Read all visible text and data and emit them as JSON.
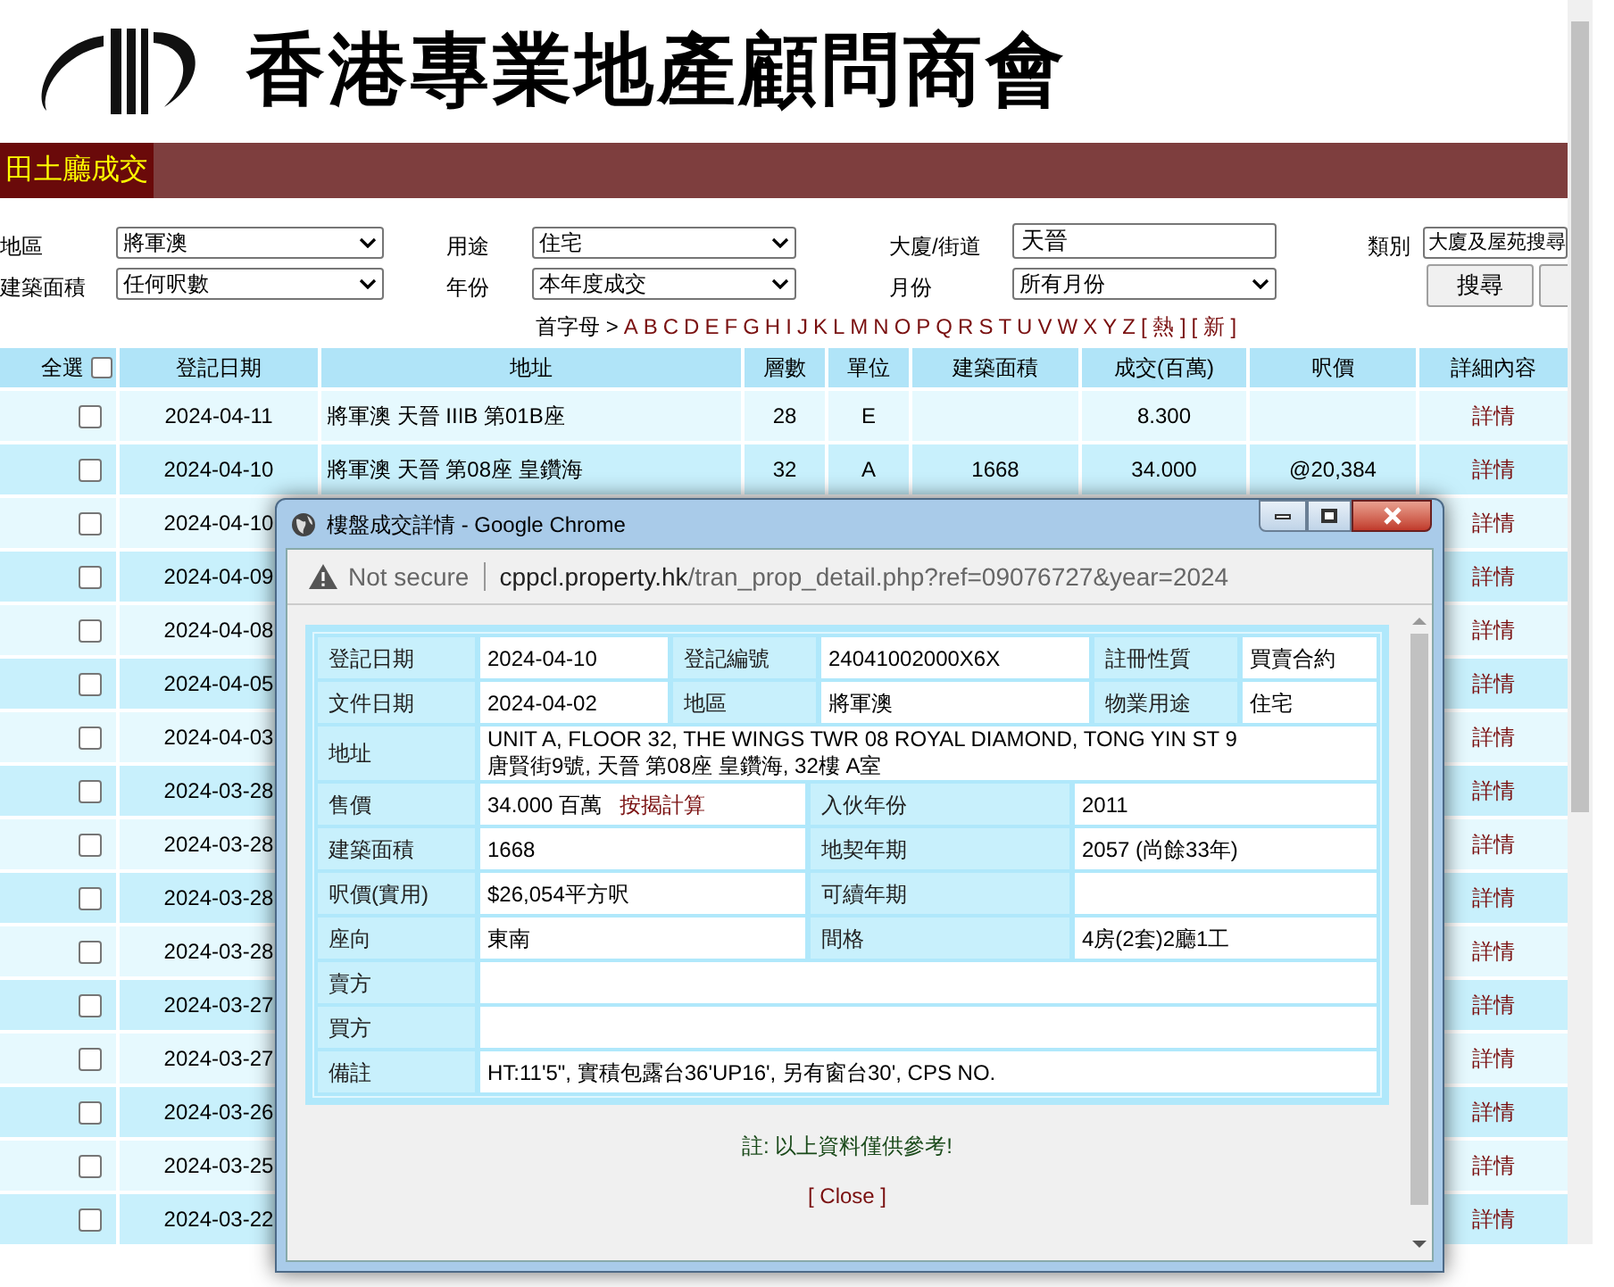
{
  "logo": {
    "title": "香港專業地產顧問商會"
  },
  "section_title": "田土廳成交",
  "filters": [
    {
      "label": "地區",
      "value": "將軍澳",
      "kind": "select"
    },
    {
      "label": "用途",
      "value": "住宅",
      "kind": "select"
    },
    {
      "label": "大廈/街道",
      "value": "天晉",
      "kind": "text"
    },
    {
      "label": "類別",
      "value": "大廈及屋苑搜尋",
      "kind": "select"
    },
    {
      "label": "建築面積",
      "value": "任何呎數",
      "kind": "select"
    },
    {
      "label": "年份",
      "value": "本年度成交",
      "kind": "select"
    },
    {
      "label": "月份",
      "value": "所有月份",
      "kind": "select"
    }
  ],
  "search_button": "搜尋",
  "letters": {
    "label": "首字母 >",
    "items": [
      "A",
      "B",
      "C",
      "D",
      "E",
      "F",
      "G",
      "H",
      "I",
      "J",
      "K",
      "L",
      "M",
      "N",
      "O",
      "P",
      "Q",
      "R",
      "S",
      "T",
      "U",
      "V",
      "W",
      "X",
      "Y",
      "Z",
      "[ 熱 ]",
      "[ 新 ]"
    ]
  },
  "table": {
    "select_all": {
      "label": "全選",
      "checked": false
    },
    "columns": [
      "登記日期",
      "地址",
      "層數",
      "單位",
      "建築面積",
      "成交(百萬)",
      "呎價",
      "詳細內容"
    ],
    "rows": [
      {
        "checked": false,
        "cells": [
          "2024-04-11",
          "將軍澳 天晉 IIIB 第01B座",
          "28",
          "E",
          "",
          "8.300",
          ""
        ],
        "detail": "詳情"
      },
      {
        "checked": false,
        "cells": [
          "2024-04-10",
          "將軍澳 天晉 第08座 皇鑽海",
          "32",
          "A",
          "1668",
          "34.000",
          "@20,384"
        ],
        "detail": "詳情"
      },
      {
        "checked": false,
        "cells": [
          "2024-04-10"
        ],
        "detail": "詳情"
      },
      {
        "checked": false,
        "cells": [
          "2024-04-09"
        ],
        "detail": "詳情"
      },
      {
        "checked": false,
        "cells": [
          "2024-04-08"
        ],
        "detail": "詳情"
      },
      {
        "checked": false,
        "cells": [
          "2024-04-05"
        ],
        "detail": "詳情"
      },
      {
        "checked": false,
        "cells": [
          "2024-04-03"
        ],
        "detail": "詳情"
      },
      {
        "checked": false,
        "cells": [
          "2024-03-28"
        ],
        "detail": "詳情"
      },
      {
        "checked": false,
        "cells": [
          "2024-03-28"
        ],
        "detail": "詳情"
      },
      {
        "checked": false,
        "cells": [
          "2024-03-28"
        ],
        "detail": "詳情"
      },
      {
        "checked": false,
        "cells": [
          "2024-03-28"
        ],
        "detail": "詳情"
      },
      {
        "checked": false,
        "cells": [
          "2024-03-27"
        ],
        "detail": "詳情"
      },
      {
        "checked": false,
        "cells": [
          "2024-03-27"
        ],
        "detail": "詳情"
      },
      {
        "checked": false,
        "cells": [
          "2024-03-26"
        ],
        "detail": "詳情"
      },
      {
        "checked": false,
        "cells": [
          "2024-03-25"
        ],
        "detail": "詳情"
      },
      {
        "checked": false,
        "cells": [
          "2024-03-22"
        ],
        "detail": "詳情"
      }
    ]
  },
  "popup": {
    "title": "樓盤成交詳情 - Google Chrome",
    "security": "Not secure",
    "url_host": "cppcl.property.hk",
    "url_path": "/tran_prop_detail.php?ref=09076727&year=2024",
    "rows": [
      {
        "cells": [
          {
            "label": "登記日期",
            "value": "2024-04-10"
          },
          {
            "label": "登記編號",
            "value": "24041002000X6X"
          },
          {
            "label": "註冊性質",
            "value": "買賣合約"
          }
        ]
      },
      {
        "cells": [
          {
            "label": "文件日期",
            "value": "2024-04-02"
          },
          {
            "label": "地區",
            "value": "將軍澳"
          },
          {
            "label": "物業用途",
            "value": "住宅"
          }
        ]
      },
      {
        "cells": [
          {
            "label": "地址",
            "lines": [
              "UNIT A, FLOOR 32, THE WINGS TWR 08 ROYAL DIAMOND, TONG YIN ST 9",
              "唐賢街9號, 天晉 第08座 皇鑽海, 32樓 A室"
            ]
          }
        ]
      },
      {
        "cells": [
          {
            "label": "售價",
            "value": "34.000 百萬",
            "link": "按揭計算"
          },
          {
            "label": "入伙年份",
            "value": "2011"
          }
        ]
      },
      {
        "cells": [
          {
            "label": "建築面積",
            "value": "1668"
          },
          {
            "label": "地契年期",
            "value": "2057 (尚餘33年)"
          }
        ]
      },
      {
        "cells": [
          {
            "label": "呎價(實用)",
            "value": "$26,054平方呎"
          },
          {
            "label": "可續年期"
          }
        ]
      },
      {
        "cells": [
          {
            "label": "座向",
            "value": "東南"
          },
          {
            "label": "間格",
            "value": "4房(2套)2廳1工"
          }
        ]
      },
      {
        "cells": [
          {
            "label": "賣方"
          }
        ]
      },
      {
        "cells": [
          {
            "label": "買方"
          }
        ]
      },
      {
        "cells": [
          {
            "label": "備註",
            "value": "HT:11'5\", 實積包露台36'UP16', 另有窗台30', CPS NO."
          }
        ]
      }
    ],
    "note": "註: 以上資料僅供參考!",
    "close": "[ Close ]"
  }
}
